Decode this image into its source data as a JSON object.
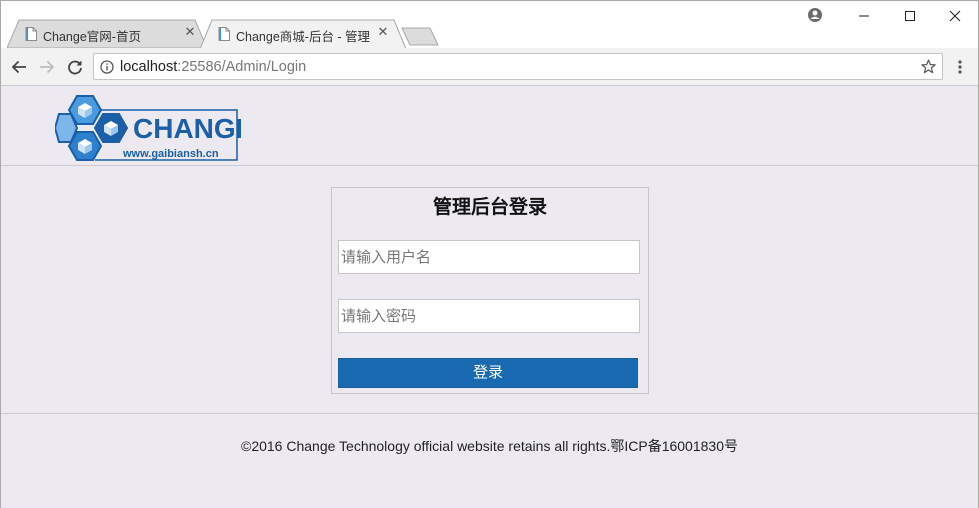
{
  "browser": {
    "tabs": [
      {
        "title": "Change官网-首页",
        "active": false
      },
      {
        "title": "Change商城-后台 - 管理",
        "active": true
      }
    ],
    "url_host": "localhost",
    "url_path": ":25586/Admin/Login",
    "icons": {
      "profile": "account-circle-icon",
      "minimize": "minimize-icon",
      "maximize": "maximize-icon",
      "close": "close-icon",
      "back": "arrow-left-icon",
      "forward": "arrow-right-icon",
      "reload": "reload-icon",
      "info": "info-icon",
      "bookmark": "star-icon",
      "menu": "kebab-menu-icon"
    }
  },
  "header": {
    "logo_text": "CHANGE",
    "logo_url": "www.gaibiansh.cn",
    "logo_color": "#1a5fa8"
  },
  "login": {
    "title": "管理后台登录",
    "username_placeholder": "请输入用户名",
    "password_placeholder": "请输入密码",
    "submit_label": "登录",
    "button_color": "#1a6ab2"
  },
  "footer": {
    "text": "©2016 Change Technology official website retains all rights.鄂ICP备16001830号"
  },
  "colors": {
    "page_background": "#ece9f1",
    "toolbar_background": "#f2f2f2"
  }
}
